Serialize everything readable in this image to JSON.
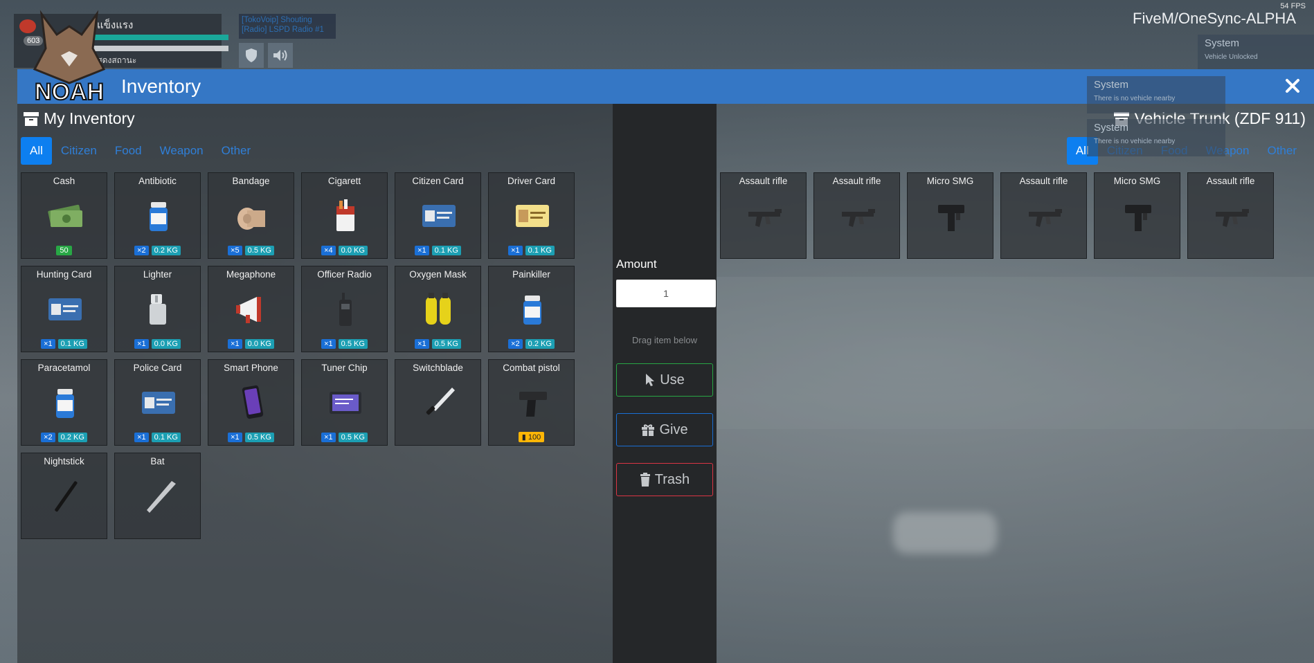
{
  "hud": {
    "fps": "54 FPS",
    "server": "FiveM/OneSync-ALPHA",
    "status_title": "แข็งแรง",
    "status_level": "603",
    "status_hint": "ค้างไว้เพื่อแสดงสถานะ",
    "voip_lines": [
      "[TokoVoip] Shouting",
      "[Radio] LSPD Radio #1"
    ],
    "notifications": [
      {
        "title": "System",
        "text": "Vehicle Unlocked"
      },
      {
        "title": "System",
        "text": "There is no vehicle nearby"
      },
      {
        "title": "System",
        "text": "There is no vehicle nearby"
      }
    ]
  },
  "window": {
    "title": "Inventory",
    "logo_text": "NOAH"
  },
  "my_inventory": {
    "title": "My Inventory",
    "tabs": [
      "All",
      "Citizen",
      "Food",
      "Weapon",
      "Other"
    ],
    "active_tab": "All",
    "items": [
      {
        "name": "Cash",
        "icon": "cash-icon",
        "count": "50"
      },
      {
        "name": "Antibiotic",
        "icon": "pill-bottle-icon",
        "qty": "×2",
        "weight": "0.2 KG"
      },
      {
        "name": "Bandage",
        "icon": "bandage-icon",
        "qty": "×5",
        "weight": "0.5 KG"
      },
      {
        "name": "Cigarett",
        "icon": "cigarette-icon",
        "qty": "×4",
        "weight": "0.0 KG"
      },
      {
        "name": "Citizen Card",
        "icon": "id-card-icon",
        "qty": "×1",
        "weight": "0.1 KG"
      },
      {
        "name": "Driver Card",
        "icon": "license-icon",
        "qty": "×1",
        "weight": "0.1 KG"
      },
      {
        "name": "Hunting Card",
        "icon": "id-card-icon",
        "qty": "×1",
        "weight": "0.1 KG"
      },
      {
        "name": "Lighter",
        "icon": "lighter-icon",
        "qty": "×1",
        "weight": "0.0 KG"
      },
      {
        "name": "Megaphone",
        "icon": "megaphone-icon",
        "qty": "×1",
        "weight": "0.0 KG"
      },
      {
        "name": "Officer Radio",
        "icon": "radio-icon",
        "qty": "×1",
        "weight": "0.5 KG"
      },
      {
        "name": "Oxygen Mask",
        "icon": "oxygen-tank-icon",
        "qty": "×1",
        "weight": "0.5 KG"
      },
      {
        "name": "Painkiller",
        "icon": "pill-bottle-icon",
        "qty": "×2",
        "weight": "0.2 KG"
      },
      {
        "name": "Paracetamol",
        "icon": "pill-bottle-icon",
        "qty": "×2",
        "weight": "0.2 KG"
      },
      {
        "name": "Police Card",
        "icon": "id-card-icon",
        "qty": "×1",
        "weight": "0.1 KG"
      },
      {
        "name": "Smart Phone",
        "icon": "phone-icon",
        "qty": "×1",
        "weight": "0.5 KG"
      },
      {
        "name": "Tuner Chip",
        "icon": "tablet-icon",
        "qty": "×1",
        "weight": "0.5 KG"
      },
      {
        "name": "Switchblade",
        "icon": "knife-icon"
      },
      {
        "name": "Combat pistol",
        "icon": "pistol-icon",
        "ammo": "100"
      },
      {
        "name": "Nightstick",
        "icon": "baton-icon"
      },
      {
        "name": "Bat",
        "icon": "bat-icon"
      }
    ]
  },
  "actions": {
    "amount_label": "Amount",
    "amount_value": "1",
    "drag_hint": "Drag item below",
    "use": "Use",
    "give": "Give",
    "trash": "Trash"
  },
  "trunk": {
    "title": "Vehicle Trunk (ZDF 911)",
    "tabs": [
      "All",
      "Citizen",
      "Food",
      "Weapon",
      "Other"
    ],
    "active_tab": "All",
    "items": [
      {
        "name": "Assault rifle",
        "icon": "rifle-icon"
      },
      {
        "name": "Assault rifle",
        "icon": "rifle-icon"
      },
      {
        "name": "Micro SMG",
        "icon": "smg-icon"
      },
      {
        "name": "Assault rifle",
        "icon": "rifle-icon"
      },
      {
        "name": "Micro SMG",
        "icon": "smg-icon"
      },
      {
        "name": "Assault rifle",
        "icon": "rifle-icon"
      }
    ]
  },
  "colors": {
    "accent": "#3577c5",
    "tab_active": "#0d7ff0",
    "use": "#28a745",
    "give": "#1a6fd6",
    "trash": "#dc3545"
  }
}
